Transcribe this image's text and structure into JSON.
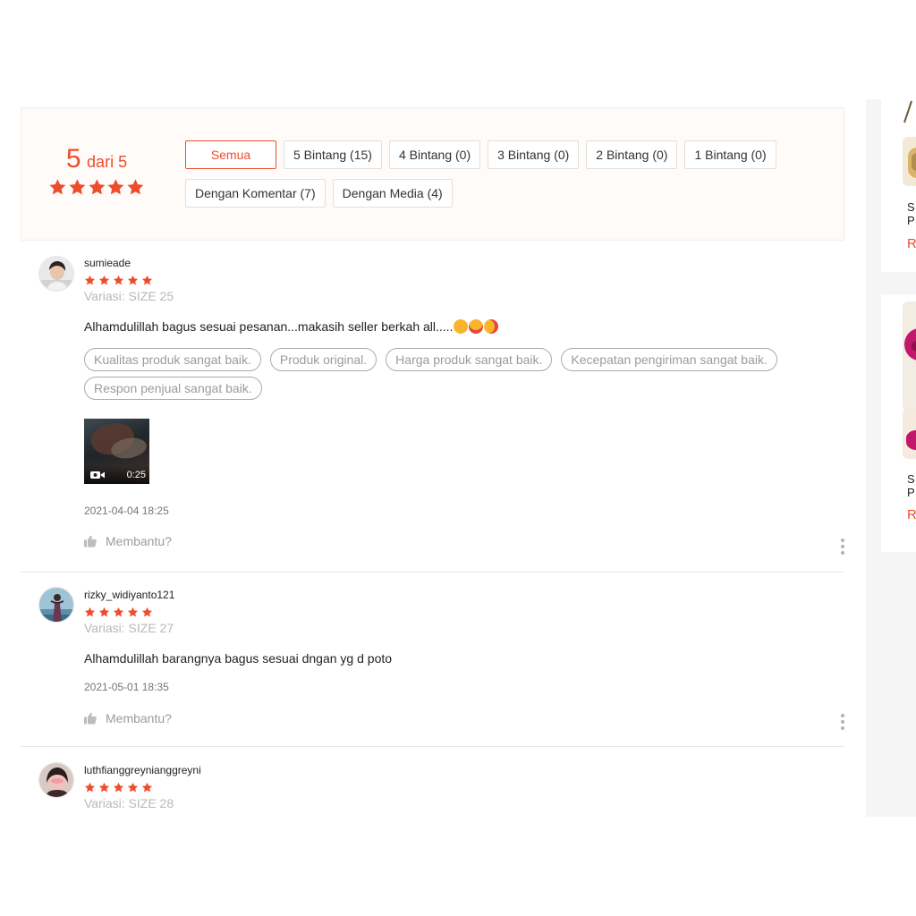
{
  "overview": {
    "score": "5",
    "score_suffix": "dari 5",
    "filters": [
      "Semua",
      "5 Bintang (15)",
      "4 Bintang (0)",
      "3 Bintang (0)",
      "2 Bintang (0)",
      "1 Bintang (0)",
      "Dengan Komentar (7)",
      "Dengan Media (4)"
    ],
    "active_filter": "Semua"
  },
  "reviews": [
    {
      "username": "sumieade",
      "rating": 5,
      "variation": "Variasi: SIZE 25",
      "comment": "Alhamdulillah bagus sesuai pesanan...makasih seller berkah all.....",
      "emojis": [
        "smiling-face-with-hearts",
        "heart-eyes",
        "face-blowing-kiss"
      ],
      "tags": [
        "Kualitas produk sangat baik.",
        "Produk original.",
        "Harga produk sangat baik.",
        "Kecepatan pengiriman sangat baik.",
        "Respon penjual sangat baik."
      ],
      "video_duration": "0:25",
      "timestamp": "2021-04-04 18:25",
      "helpful_label": "Membantu?"
    },
    {
      "username": "rizky_widiyanto121",
      "rating": 5,
      "variation": "Variasi: SIZE 27",
      "comment": "Alhamdulillah barangnya bagus sesuai dngan yg d poto",
      "timestamp": "2021-05-01 18:35",
      "helpful_label": "Membantu?"
    },
    {
      "username": "luthfianggreynianggreyni",
      "rating": 5,
      "variation": "Variasi: SIZE 28"
    }
  ],
  "sidebar": {
    "cards": [
      {
        "title": "S",
        "subtitle": "P",
        "price": "R"
      },
      {
        "title": "S",
        "subtitle": "P",
        "price": "R"
      }
    ]
  },
  "colors": {
    "accent": "#ee4d2d",
    "overview_bg": "#fffbf8",
    "muted_text": "#9b9b9b",
    "sidebar_bg": "#f5f5f5"
  },
  "icons": [
    "star-icon",
    "thumbs-up-icon",
    "more-vertical-icon",
    "video-camera-icon"
  ]
}
